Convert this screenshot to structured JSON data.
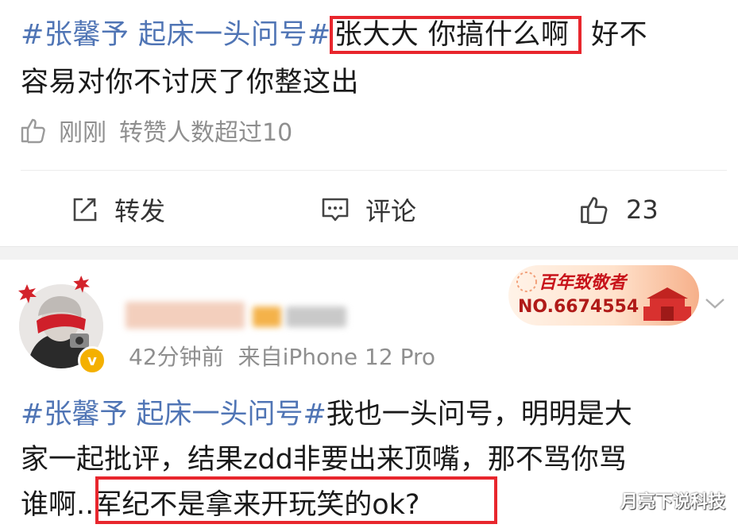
{
  "post1": {
    "hashtag": "#张馨予 起床一头问号#",
    "highlight": "张大大 你搞什么啊",
    "text_after": "好不",
    "line2": "容易对你不讨厌了你整这出",
    "time": "刚刚",
    "repost_note": "转赞人数超过10"
  },
  "actions": {
    "repost": "转发",
    "comment": "评论",
    "like_count": "23"
  },
  "post2": {
    "time": "42分钟前",
    "source": "来自iPhone 12 Pro",
    "award_title": "百年致敬者",
    "award_no": "NO.6674554",
    "line1_hashtag": "#张馨予 起床一头问号#",
    "line1_rest": "我也一头问号，明明是大",
    "line2": "家一起批评，结果zdd非要出来顶嘴，那不骂你骂",
    "line3": "谁啊..军纪不是拿来开玩笑的ok?"
  },
  "watermark": "月亮下说科技",
  "colors": {
    "hashtag": "#5075b5",
    "highlight_border": "#e8262d",
    "meta": "#8f8f8f",
    "verified": "#f4b000"
  }
}
